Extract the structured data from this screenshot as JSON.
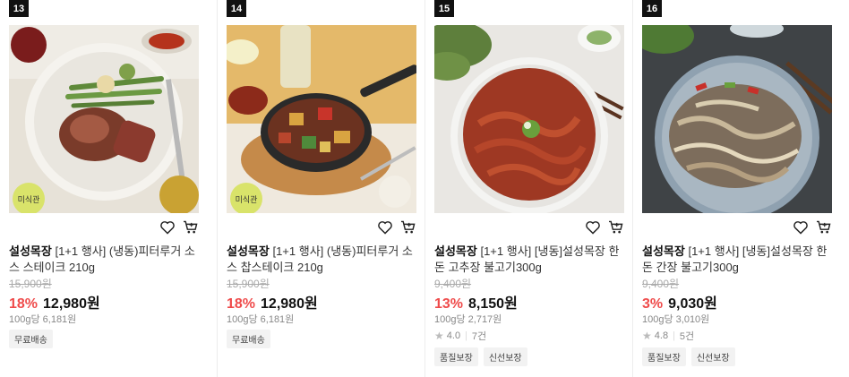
{
  "products": [
    {
      "rank": "13",
      "badge": "미식관",
      "brand": "설성목장",
      "title_rest": " [1+1 행사] (냉동)피터루거 소스 스테이크 210g",
      "original_price": "15,900원",
      "discount": "18%",
      "price": "12,980원",
      "unit_price": "100g당 6,181원",
      "tags": [
        "무료배송"
      ]
    },
    {
      "rank": "14",
      "badge": "미식관",
      "brand": "설성목장",
      "title_rest": " [1+1 행사] (냉동)피터루거 소스 찹스테이크 210g",
      "original_price": "15,900원",
      "discount": "18%",
      "price": "12,980원",
      "unit_price": "100g당 6,181원",
      "tags": [
        "무료배송"
      ]
    },
    {
      "rank": "15",
      "brand": "설성목장",
      "title_rest": " [1+1 행사] [냉동]설성목장 한돈 고추장 불고기300g",
      "original_price": "9,400원",
      "discount": "13%",
      "price": "8,150원",
      "unit_price": "100g당 2,717원",
      "rating": "4.0",
      "reviews": "7건",
      "tags": [
        "품질보장",
        "신선보장"
      ]
    },
    {
      "rank": "16",
      "brand": "설성목장",
      "title_rest": " [1+1 행사] [냉동]설성목장 한돈 간장 불고기300g",
      "original_price": "9,400원",
      "discount": "3%",
      "price": "9,030원",
      "unit_price": "100g당 3,010원",
      "rating": "4.8",
      "reviews": "5건",
      "tags": [
        "품질보장",
        "신선보장"
      ]
    }
  ],
  "icons": {
    "wishlist": "heart-outline-icon",
    "cart": "cart-icon",
    "rating": "star-icon"
  },
  "colors": {
    "discount": "#ef4b4b",
    "badge": "#d9e36a"
  }
}
